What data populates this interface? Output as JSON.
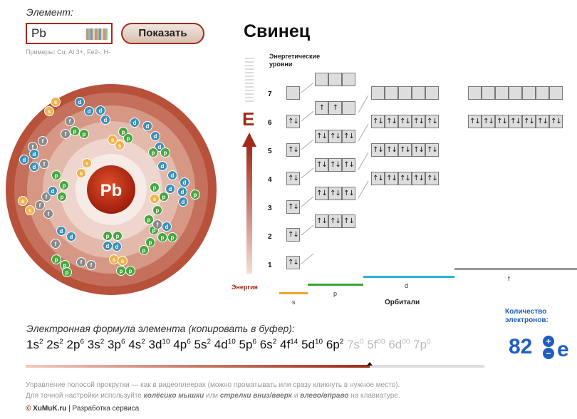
{
  "input": {
    "label": "Элемент:",
    "value": "Pb",
    "examples": "Примеры: Cu, Al 3+, Fe2-, H-"
  },
  "button": {
    "show_label": "Показать"
  },
  "element": {
    "name": "Свинец",
    "symbol": "Pb"
  },
  "diagram": {
    "axis_title_1": "Энергетические",
    "axis_title_2": "уровни",
    "energy_letter": "E",
    "energy_label": "Энергия",
    "levels": [
      "7",
      "6",
      "5",
      "4",
      "3",
      "2",
      "1"
    ],
    "orbitals_label": "Орбитали",
    "sublevels": [
      "s",
      "p",
      "d",
      "f"
    ],
    "cell_up": "↑",
    "cell_pair": "↑↓",
    "colors": {
      "s": "#f3a52a",
      "p": "#3aa33a",
      "d": "#2bb5d6",
      "f": "#999999",
      "accent": "#a32a1a"
    }
  },
  "atom_labels": {
    "s": "s",
    "p": "p",
    "d": "d",
    "f": "f"
  },
  "formula": {
    "label": "Электронная формула элемента (копировать в буфер):",
    "terms": [
      {
        "t": "1s",
        "e": "2"
      },
      {
        "t": "2s",
        "e": "2"
      },
      {
        "t": "2p",
        "e": "6"
      },
      {
        "t": "3s",
        "e": "2"
      },
      {
        "t": "3p",
        "e": "6"
      },
      {
        "t": "4s",
        "e": "2"
      },
      {
        "t": "3d",
        "e": "10"
      },
      {
        "t": "4p",
        "e": "6"
      },
      {
        "t": "5s",
        "e": "2"
      },
      {
        "t": "4d",
        "e": "10"
      },
      {
        "t": "5p",
        "e": "6"
      },
      {
        "t": "6s",
        "e": "2"
      },
      {
        "t": "4f",
        "e": "14"
      },
      {
        "t": "5d",
        "e": "10"
      },
      {
        "t": "6p",
        "e": "2"
      }
    ],
    "dim_terms": [
      {
        "t": "7s",
        "e": "0"
      },
      {
        "t": "5f",
        "e": "00"
      },
      {
        "t": "6d",
        "e": "00"
      },
      {
        "t": "7p",
        "e": "0"
      }
    ]
  },
  "electron_count": {
    "label_1": "Количество",
    "label_2": "электронов:",
    "value": "82"
  },
  "scroll": {
    "progress": 0.75
  },
  "help": {
    "line1": "Управление полосой прокрутки — как в видеоплеерах (можно проматывать или сразу кликнуть в нужное место).",
    "line2_a": "Для точной настройки используйте",
    "wheel": "колёсико мышки",
    "or": "или",
    "arrows_ud": "стрелки вниз/вверх",
    "and": "и",
    "arrows_lr": "влево/вправо",
    "line2_end": "на клавиатуре."
  },
  "footer": {
    "brand": "XuMuK.ru",
    "separator": "|",
    "service": "Разработка сервиса"
  }
}
